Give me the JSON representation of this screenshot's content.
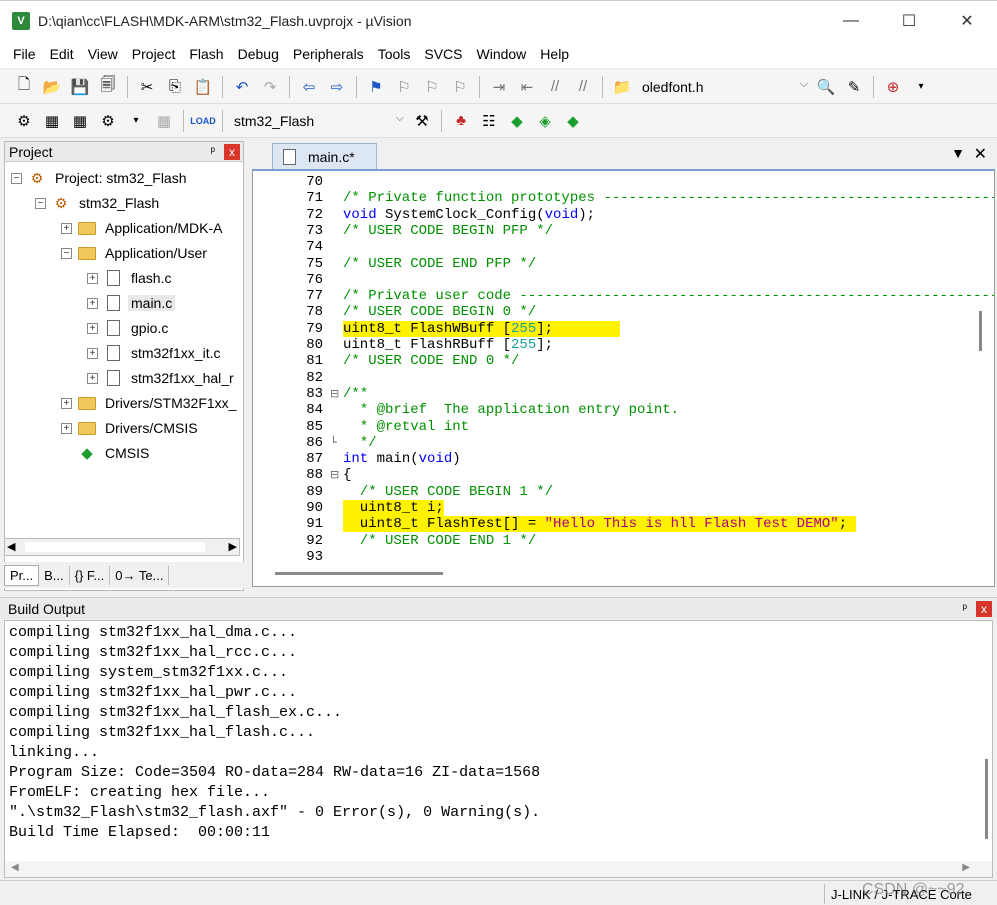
{
  "window": {
    "title": "D:\\qian\\cc\\FLASH\\MDK-ARM\\stm32_Flash.uvprojx - µVision",
    "app_icon": "V",
    "minimize": "—",
    "maximize": "☐",
    "close": "✕"
  },
  "menu": [
    "File",
    "Edit",
    "View",
    "Project",
    "Flash",
    "Debug",
    "Peripherals",
    "Tools",
    "SVCS",
    "Window",
    "Help"
  ],
  "toolbar1": {
    "find_file": "oledfont.h"
  },
  "toolbar2": {
    "target": "stm32_Flash"
  },
  "project_panel": {
    "title": "Project",
    "pin": "ᵖ",
    "close": "x",
    "tree": [
      {
        "label": "Project: stm32_Flash",
        "level": 0,
        "icon": "project-icon",
        "expander": "−"
      },
      {
        "label": "stm32_Flash",
        "level": 1,
        "icon": "target-icon",
        "expander": "−"
      },
      {
        "label": "Application/MDK-A",
        "level": 2,
        "icon": "folder-icon",
        "expander": "+"
      },
      {
        "label": "Application/User",
        "level": 2,
        "icon": "folder-icon",
        "expander": "−"
      },
      {
        "label": "flash.c",
        "level": 3,
        "icon": "file-icon",
        "expander": "+"
      },
      {
        "label": "main.c",
        "level": 3,
        "icon": "file-icon",
        "expander": "+",
        "selected": true
      },
      {
        "label": "gpio.c",
        "level": 3,
        "icon": "file-icon",
        "expander": "+"
      },
      {
        "label": "stm32f1xx_it.c",
        "level": 3,
        "icon": "file-icon",
        "expander": "+"
      },
      {
        "label": "stm32f1xx_hal_r",
        "level": 3,
        "icon": "file-icon",
        "expander": "+"
      },
      {
        "label": "Drivers/STM32F1xx_",
        "level": 2,
        "icon": "folder-icon",
        "expander": "+"
      },
      {
        "label": "Drivers/CMSIS",
        "level": 2,
        "icon": "folder-icon",
        "expander": "+"
      },
      {
        "label": "CMSIS",
        "level": 2,
        "icon": "cmsis-icon",
        "expander": ""
      }
    ],
    "tabs": [
      "Pr...",
      "B...",
      "{} F...",
      "0→ Te..."
    ]
  },
  "editor": {
    "tab_label": "main.c*",
    "lines": [
      {
        "n": "70",
        "fold": "",
        "hl": false,
        "parts": []
      },
      {
        "n": "71",
        "fold": "",
        "hl": false,
        "parts": [
          {
            "c": "cm",
            "t": "/* Private function prototypes -----------------------------------------------"
          }
        ]
      },
      {
        "n": "72",
        "fold": "",
        "hl": false,
        "parts": [
          {
            "c": "kw",
            "t": "void"
          },
          {
            "c": "tx",
            "t": " SystemClock_Config("
          },
          {
            "c": "kw",
            "t": "void"
          },
          {
            "c": "tx",
            "t": ");"
          }
        ]
      },
      {
        "n": "73",
        "fold": "",
        "hl": false,
        "parts": [
          {
            "c": "cm",
            "t": "/* USER CODE BEGIN PFP */"
          }
        ]
      },
      {
        "n": "74",
        "fold": "",
        "hl": false,
        "parts": []
      },
      {
        "n": "75",
        "fold": "",
        "hl": false,
        "parts": [
          {
            "c": "cm",
            "t": "/* USER CODE END PFP */"
          }
        ]
      },
      {
        "n": "76",
        "fold": "",
        "hl": false,
        "parts": []
      },
      {
        "n": "77",
        "fold": "",
        "hl": false,
        "parts": [
          {
            "c": "cm",
            "t": "/* Private user code ---------------------------------------------------------"
          }
        ]
      },
      {
        "n": "78",
        "fold": "",
        "hl": false,
        "parts": [
          {
            "c": "cm",
            "t": "/* USER CODE BEGIN 0 */"
          }
        ]
      },
      {
        "n": "79",
        "fold": "",
        "hl": true,
        "parts": [
          {
            "c": "tx",
            "t": "uint8_t FlashWBuff ["
          },
          {
            "c": "num",
            "t": "255"
          },
          {
            "c": "tx",
            "t": "];        "
          }
        ]
      },
      {
        "n": "80",
        "fold": "",
        "hl": false,
        "parts": [
          {
            "c": "tx",
            "t": "uint8_t FlashRBuff ["
          },
          {
            "c": "num",
            "t": "255"
          },
          {
            "c": "tx",
            "t": "];"
          }
        ]
      },
      {
        "n": "81",
        "fold": "",
        "hl": false,
        "parts": [
          {
            "c": "cm",
            "t": "/* USER CODE END 0 */"
          }
        ]
      },
      {
        "n": "82",
        "fold": "",
        "hl": false,
        "parts": []
      },
      {
        "n": "83",
        "fold": "⊟",
        "hl": false,
        "parts": [
          {
            "c": "cm",
            "t": "/**"
          }
        ]
      },
      {
        "n": "84",
        "fold": "",
        "hl": false,
        "parts": [
          {
            "c": "cm",
            "t": "  * @brief  The application entry point."
          }
        ]
      },
      {
        "n": "85",
        "fold": "",
        "hl": false,
        "parts": [
          {
            "c": "cm",
            "t": "  * @retval int"
          }
        ]
      },
      {
        "n": "86",
        "fold": "└",
        "hl": false,
        "parts": [
          {
            "c": "cm",
            "t": "  */"
          }
        ]
      },
      {
        "n": "87",
        "fold": "",
        "hl": false,
        "parts": [
          {
            "c": "kw",
            "t": "int"
          },
          {
            "c": "tx",
            "t": " main("
          },
          {
            "c": "kw",
            "t": "void"
          },
          {
            "c": "tx",
            "t": ")"
          }
        ]
      },
      {
        "n": "88",
        "fold": "⊟",
        "hl": false,
        "parts": [
          {
            "c": "tx",
            "t": "{"
          }
        ]
      },
      {
        "n": "89",
        "fold": "",
        "hl": false,
        "parts": [
          {
            "c": "cm",
            "t": "  /* USER CODE BEGIN 1 */"
          }
        ]
      },
      {
        "n": "90",
        "fold": "",
        "hl": true,
        "parts": [
          {
            "c": "tx",
            "t": "  uint8_t i;"
          }
        ]
      },
      {
        "n": "91",
        "fold": "",
        "hl": true,
        "parts": [
          {
            "c": "tx",
            "t": "  uint8_t FlashTest[] = "
          },
          {
            "c": "str",
            "t": "\"Hello This is hll Flash Test DEMO\""
          },
          {
            "c": "tx",
            "t": "; "
          }
        ]
      },
      {
        "n": "92",
        "fold": "",
        "hl": false,
        "parts": [
          {
            "c": "cm",
            "t": "  /* USER CODE END 1 */"
          }
        ]
      },
      {
        "n": "93",
        "fold": "",
        "hl": false,
        "parts": []
      }
    ]
  },
  "build_output": {
    "title": "Build Output",
    "pin": "ᵖ",
    "close": "x",
    "lines": [
      "compiling stm32f1xx_hal_dma.c...",
      "compiling stm32f1xx_hal_rcc.c...",
      "compiling system_stm32f1xx.c...",
      "compiling stm32f1xx_hal_pwr.c...",
      "compiling stm32f1xx_hal_flash_ex.c...",
      "compiling stm32f1xx_hal_flash.c...",
      "linking...",
      "Program Size: Code=3504 RO-data=284 RW-data=16 ZI-data=1568",
      "FromELF: creating hex file...",
      "\".\\stm32_Flash\\stm32_flash.axf\" - 0 Error(s), 0 Warning(s).",
      "Build Time Elapsed:  00:00:11"
    ]
  },
  "status": {
    "debugger": "J-LINK / J-TRACE Corte",
    "watermark": "CSDN @~~92"
  }
}
